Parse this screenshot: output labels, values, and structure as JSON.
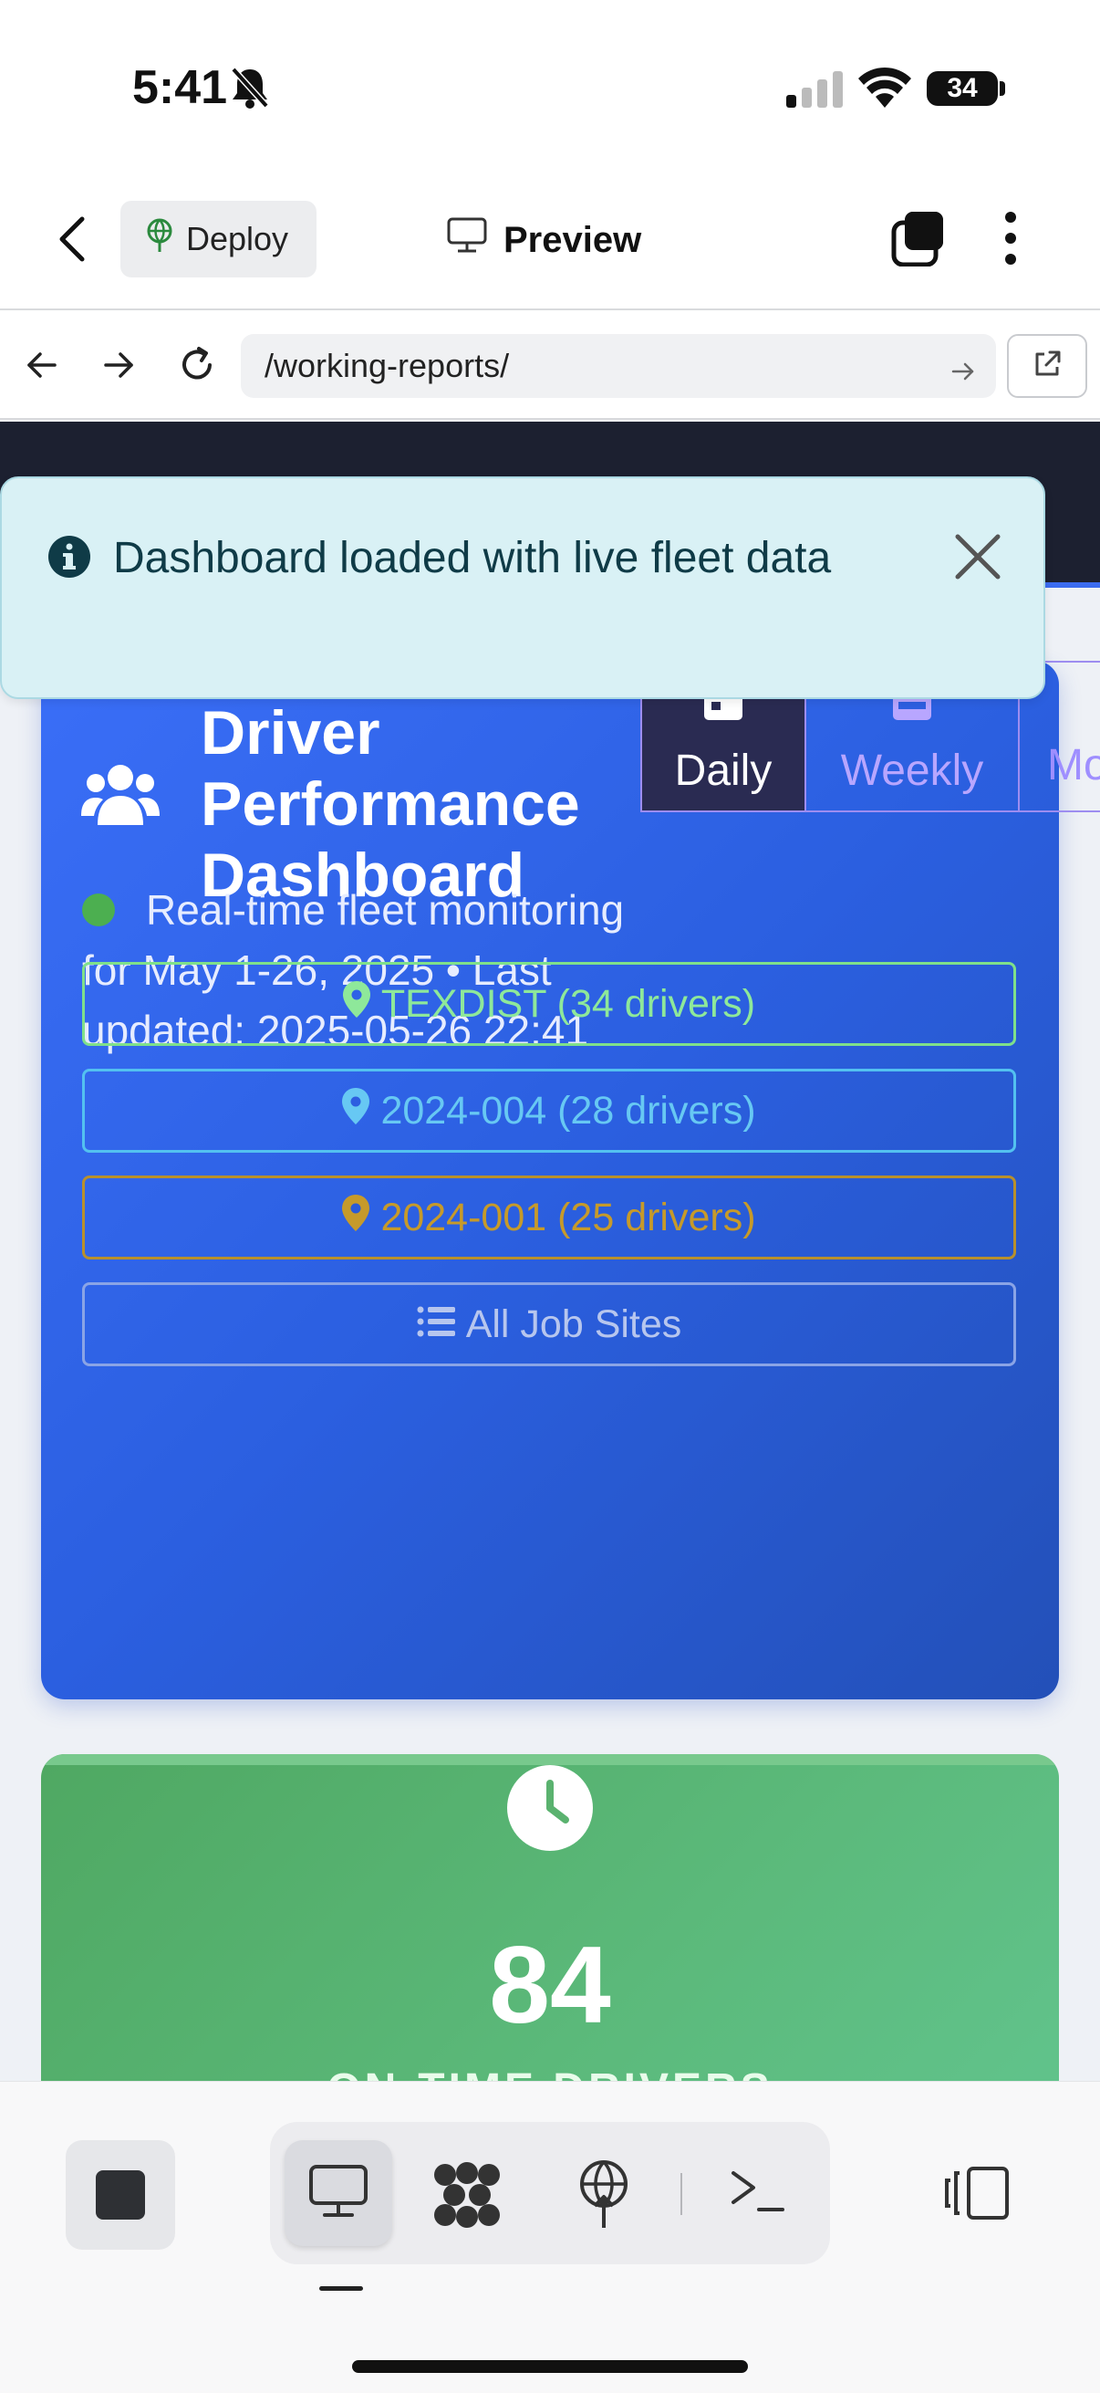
{
  "status": {
    "time": "5:41",
    "battery": "34"
  },
  "header": {
    "deploy_label": "Deploy",
    "preview_label": "Preview"
  },
  "browser": {
    "url": "/working-reports/"
  },
  "toast": {
    "message": "Dashboard loaded with live fleet data"
  },
  "hero": {
    "title": "Driver Performance Dashboard",
    "subtitle": "Real-time fleet monitoring for May 1-26, 2025 • Last updated: 2025-05-26 22:41",
    "tabs": [
      {
        "label": "Daily",
        "active": true
      },
      {
        "label": "Weekly",
        "active": false
      },
      {
        "label": "Mo",
        "active": false
      }
    ],
    "buttons": [
      {
        "label": "TEXDIST (34 drivers)",
        "color": "#8ee89a"
      },
      {
        "label": "2024-004 (28 drivers)",
        "color": "#67c8f3"
      },
      {
        "label": "2024-001 (25 drivers)",
        "color": "#c69a2a"
      },
      {
        "label": "All Job Sites",
        "color": "#b7c6ee"
      }
    ]
  },
  "stat_card": {
    "value": "84",
    "label": "ON-TIME DRIVERS"
  },
  "colors": {
    "hero_blue": "#3a6ef7",
    "stat_green": "#5bb97a",
    "toast_bg": "#d9f1f5"
  }
}
